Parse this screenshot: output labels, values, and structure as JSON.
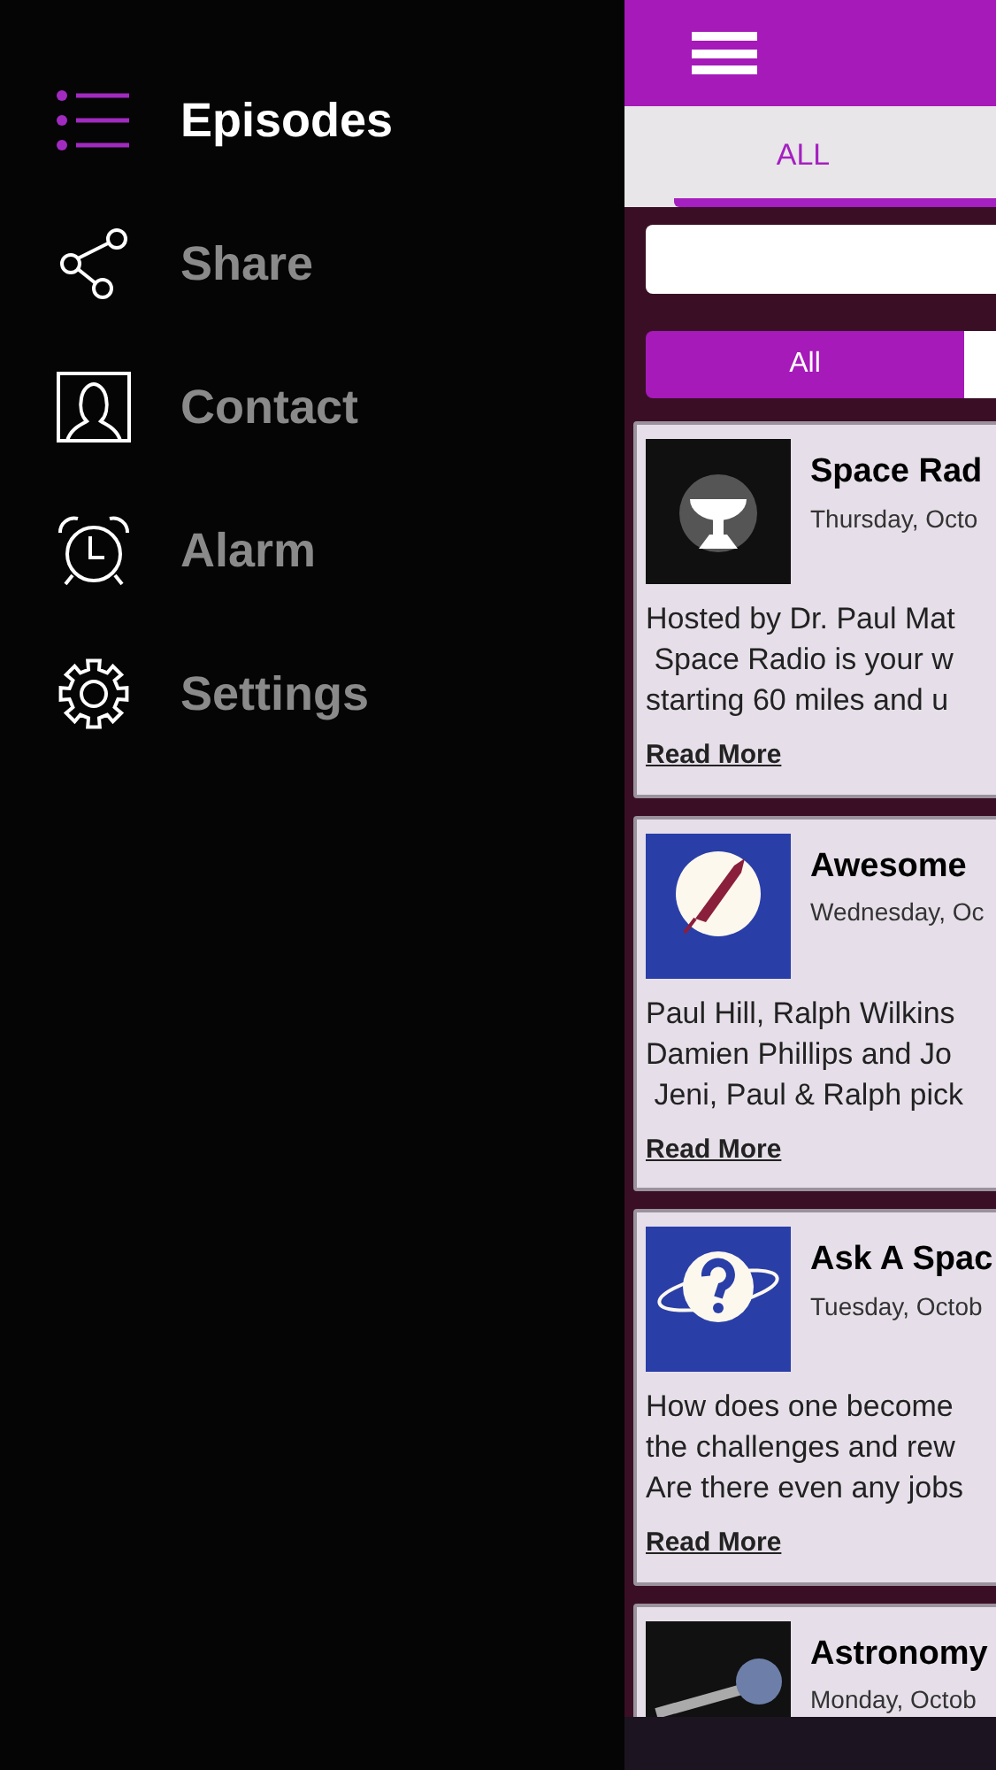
{
  "menu": [
    {
      "label": "Episodes",
      "selected": true
    },
    {
      "label": "Share",
      "selected": false
    },
    {
      "label": "Contact",
      "selected": false
    },
    {
      "label": "Alarm",
      "selected": false
    },
    {
      "label": "Settings",
      "selected": false
    }
  ],
  "tabs": [
    {
      "label": "ALL",
      "selected": true
    }
  ],
  "segments": [
    {
      "label": "All",
      "selected": true
    },
    {
      "selected": false
    }
  ],
  "episodes": [
    {
      "title": "Space Rad",
      "date": "Thursday, Octo",
      "description": "Hosted by Dr. Paul Mat\n Space Radio is your w\nstarting 60 miles and u",
      "link": "Read More"
    },
    {
      "title": "Awesome",
      "date": "Wednesday, Oc",
      "description": "Paul Hill, Ralph Wilkins\nDamien Phillips and Jo\n Jeni, Paul & Ralph pick",
      "link": "Read More"
    },
    {
      "title": "Ask A Spac",
      "date": "Tuesday, Octob",
      "description": "How does one become\nthe challenges and rew\nAre there even any jobs",
      "link": "Read More"
    },
    {
      "title": "Astronomy",
      "date": "Monday, Octob"
    }
  ]
}
